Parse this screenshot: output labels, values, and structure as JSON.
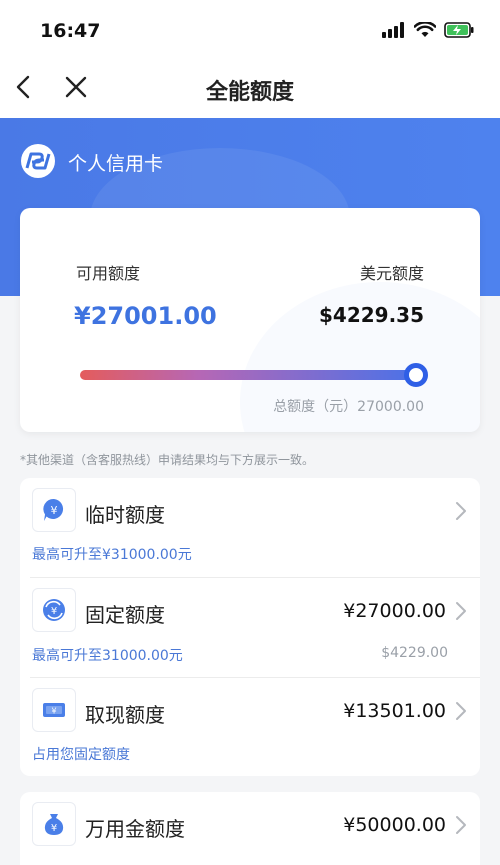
{
  "status_bar": {
    "time": "16:47"
  },
  "nav": {
    "title": "全能额度"
  },
  "brand": {
    "name": "个人信用卡"
  },
  "summary": {
    "available_label": "可用额度",
    "available_amount": "¥27001.00",
    "usd_label": "美元额度",
    "usd_amount": "$4229.35",
    "total_text": "总额度（元）27000.00",
    "progress_ratio": 1.0
  },
  "notice": "*其他渠道（含客服热线）申请结果均与下方展示一致。",
  "limits": [
    {
      "title": "临时额度",
      "amount": "",
      "sub_left": "最高可升至¥31000.00元",
      "sub_right": ""
    },
    {
      "title": "固定额度",
      "amount": "¥27000.00",
      "sub_left": "最高可升至31000.00元",
      "sub_right": "$4229.00"
    },
    {
      "title": "取现额度",
      "amount": "¥13501.00",
      "sub_left": "占用您固定额度",
      "sub_right": ""
    }
  ],
  "wanyongjin": {
    "title": "万用金额度",
    "amount": "¥50000.00"
  },
  "colors": {
    "brand_blue": "#4a79e6",
    "accent_blue": "#3e73e0",
    "link_blue": "#4a78d6"
  }
}
